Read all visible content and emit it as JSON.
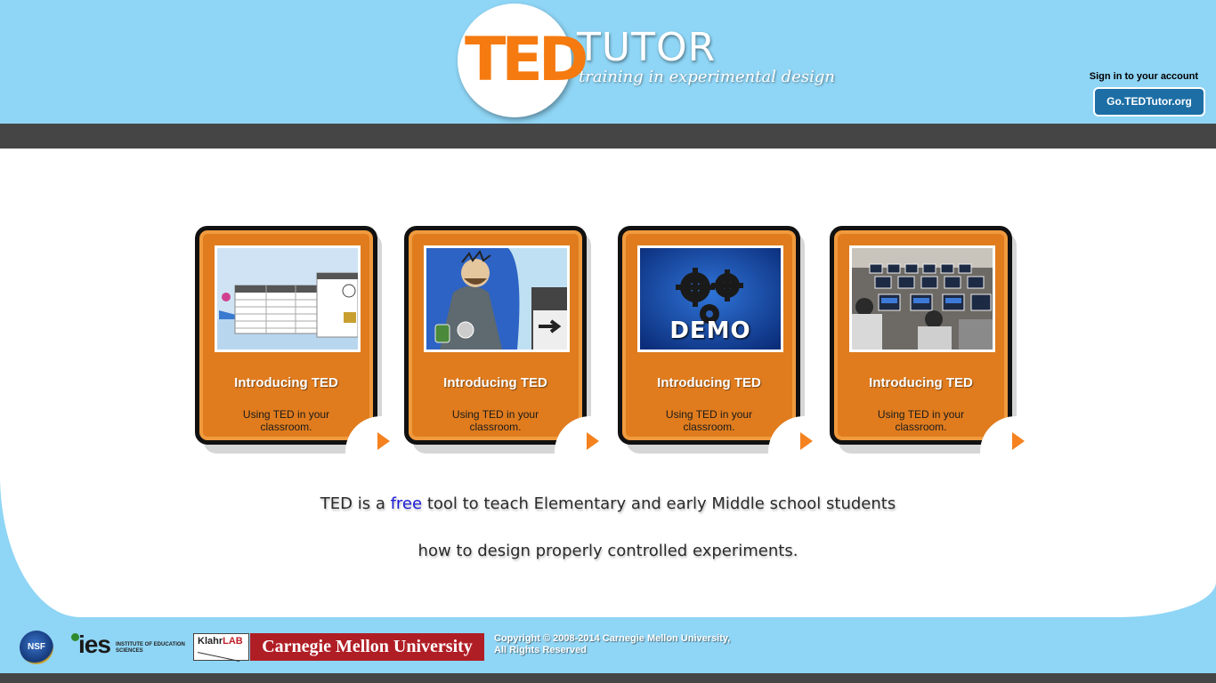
{
  "header": {
    "logo_ted": "TED",
    "logo_tutor": "TUTOR",
    "logo_tagline": "training in experimental design",
    "signin_label": "Sign in to your account",
    "signin_button": "Go.TEDTutor.org"
  },
  "cards": [
    {
      "title": "Introducing TED",
      "desc": "Using TED in your classroom.",
      "image": "ramps-table-screenshot"
    },
    {
      "title": "Introducing TED",
      "desc": "Using TED in your classroom.",
      "image": "scientist-cartoon"
    },
    {
      "title": "Introducing TED",
      "desc": "Using TED in your classroom.",
      "image": "demo-gears",
      "image_label": "DEMO"
    },
    {
      "title": "Introducing TED",
      "desc": "Using TED in your classroom.",
      "image": "classroom-photo"
    }
  ],
  "tagline": {
    "pre": "TED is a ",
    "free": "free",
    "post": " tool to teach Elementary and early Middle school students",
    "line2": "how to design properly controlled experiments."
  },
  "footer": {
    "nsf": "NSF",
    "ies": "ies",
    "ies_sub": "Institute of Education Sciences",
    "klahr": "Klahr",
    "klahr_lab": "LAB",
    "cmu": "Carnegie Mellon University",
    "copyright_line1": "Copyright © 2008-2014 Carnegie Mellon University,",
    "copyright_line2": "All Rights Reserved"
  },
  "colors": {
    "sky": "#8fd5f5",
    "bar": "#454545",
    "card_orange": "#e07c1e",
    "button_blue": "#1c6ea5",
    "cmu_red": "#b01e25",
    "free_blue": "#1a1ad8"
  }
}
